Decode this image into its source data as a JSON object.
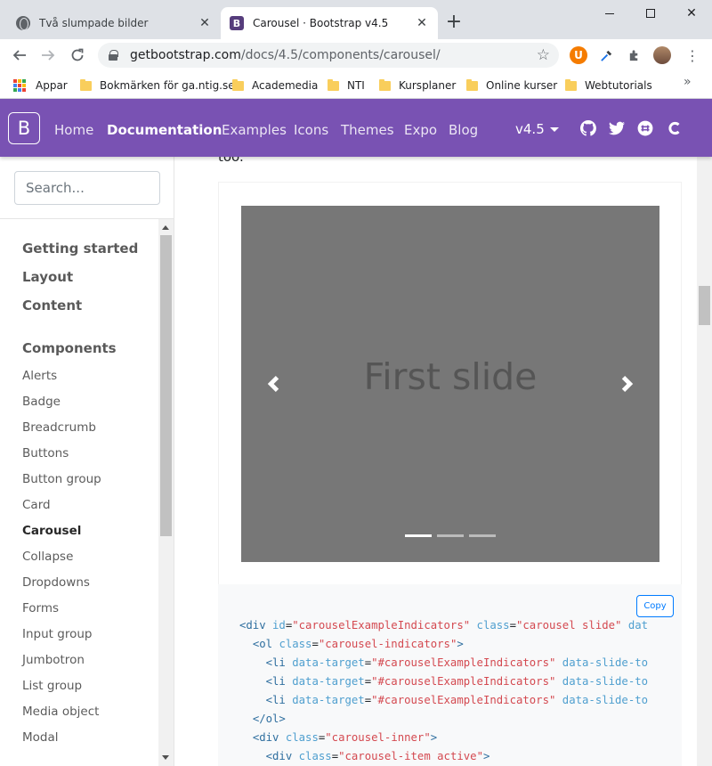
{
  "browser": {
    "tabs": [
      {
        "title": "Två slumpade bilder",
        "active": false,
        "favicon": "globe-icon"
      },
      {
        "title": "Carousel · Bootstrap v4.5",
        "active": true,
        "favicon": "bootstrap-icon"
      }
    ],
    "new_tab": "+",
    "url_host": "getbootstrap.com",
    "url_path": "/docs/4.5/components/carousel/",
    "bookmarks": [
      {
        "label": "Appar",
        "icon": "apps-grid-icon"
      },
      {
        "label": "Bokmärken för ga.ntig.se",
        "icon": "folder-icon"
      },
      {
        "label": "Academedia",
        "icon": "folder-icon"
      },
      {
        "label": "NTI",
        "icon": "folder-icon"
      },
      {
        "label": "Kursplaner",
        "icon": "folder-icon"
      },
      {
        "label": "Online kurser",
        "icon": "folder-icon"
      },
      {
        "label": "Webtutorials",
        "icon": "folder-icon"
      }
    ],
    "more_bookmarks": "»"
  },
  "navbar": {
    "brand": "B",
    "links": [
      {
        "label": "Home",
        "active": false
      },
      {
        "label": "Documentation",
        "active": true
      },
      {
        "label": "Examples",
        "active": false
      },
      {
        "label": "Icons",
        "active": false
      },
      {
        "label": "Themes",
        "active": false
      },
      {
        "label": "Expo",
        "active": false
      },
      {
        "label": "Blog",
        "active": false
      }
    ],
    "version": "v4.5",
    "accent_color": "#7952b3",
    "icons": [
      "github-icon",
      "twitter-icon",
      "slack-icon",
      "opencollective-icon"
    ]
  },
  "sidebar": {
    "search_placeholder": "Search...",
    "groups": [
      "Getting started",
      "Layout",
      "Content",
      "Components"
    ],
    "items": [
      "Alerts",
      "Badge",
      "Breadcrumb",
      "Buttons",
      "Button group",
      "Card",
      "Carousel",
      "Collapse",
      "Dropdowns",
      "Forms",
      "Input group",
      "Jumbotron",
      "List group",
      "Media object",
      "Modal"
    ],
    "current_item": "Carousel"
  },
  "content": {
    "intro_text": "too.",
    "carousel": {
      "caption": "First slide",
      "slide_color": "#777777",
      "indicator_count": 3,
      "active_indicator": 0
    },
    "copy_label": "Copy",
    "code_lines": [
      [
        [
          "tag",
          "<div "
        ],
        [
          "attr",
          "id"
        ],
        [
          "eq",
          "="
        ],
        [
          "val",
          "\"carouselExampleIndicators\""
        ],
        [
          "eq",
          " "
        ],
        [
          "attr",
          "class"
        ],
        [
          "eq",
          "="
        ],
        [
          "val",
          "\"carousel slide\""
        ],
        [
          "eq",
          " "
        ],
        [
          "attr",
          "dat"
        ]
      ],
      [
        [
          "eq",
          "  "
        ],
        [
          "tag",
          "<ol "
        ],
        [
          "attr",
          "class"
        ],
        [
          "eq",
          "="
        ],
        [
          "val",
          "\"carousel-indicators\""
        ],
        [
          "tag",
          ">"
        ]
      ],
      [
        [
          "eq",
          "    "
        ],
        [
          "tag",
          "<li "
        ],
        [
          "attr",
          "data-target"
        ],
        [
          "eq",
          "="
        ],
        [
          "val",
          "\"#carouselExampleIndicators\""
        ],
        [
          "eq",
          " "
        ],
        [
          "attr",
          "data-slide-to"
        ]
      ],
      [
        [
          "eq",
          "    "
        ],
        [
          "tag",
          "<li "
        ],
        [
          "attr",
          "data-target"
        ],
        [
          "eq",
          "="
        ],
        [
          "val",
          "\"#carouselExampleIndicators\""
        ],
        [
          "eq",
          " "
        ],
        [
          "attr",
          "data-slide-to"
        ]
      ],
      [
        [
          "eq",
          "    "
        ],
        [
          "tag",
          "<li "
        ],
        [
          "attr",
          "data-target"
        ],
        [
          "eq",
          "="
        ],
        [
          "val",
          "\"#carouselExampleIndicators\""
        ],
        [
          "eq",
          " "
        ],
        [
          "attr",
          "data-slide-to"
        ]
      ],
      [
        [
          "eq",
          "  "
        ],
        [
          "tag",
          "</ol>"
        ]
      ],
      [
        [
          "eq",
          "  "
        ],
        [
          "tag",
          "<div "
        ],
        [
          "attr",
          "class"
        ],
        [
          "eq",
          "="
        ],
        [
          "val",
          "\"carousel-inner\""
        ],
        [
          "tag",
          ">"
        ]
      ],
      [
        [
          "eq",
          "    "
        ],
        [
          "tag",
          "<div "
        ],
        [
          "attr",
          "class"
        ],
        [
          "eq",
          "="
        ],
        [
          "val",
          "\"carousel-item active\""
        ],
        [
          "tag",
          ">"
        ]
      ]
    ]
  }
}
